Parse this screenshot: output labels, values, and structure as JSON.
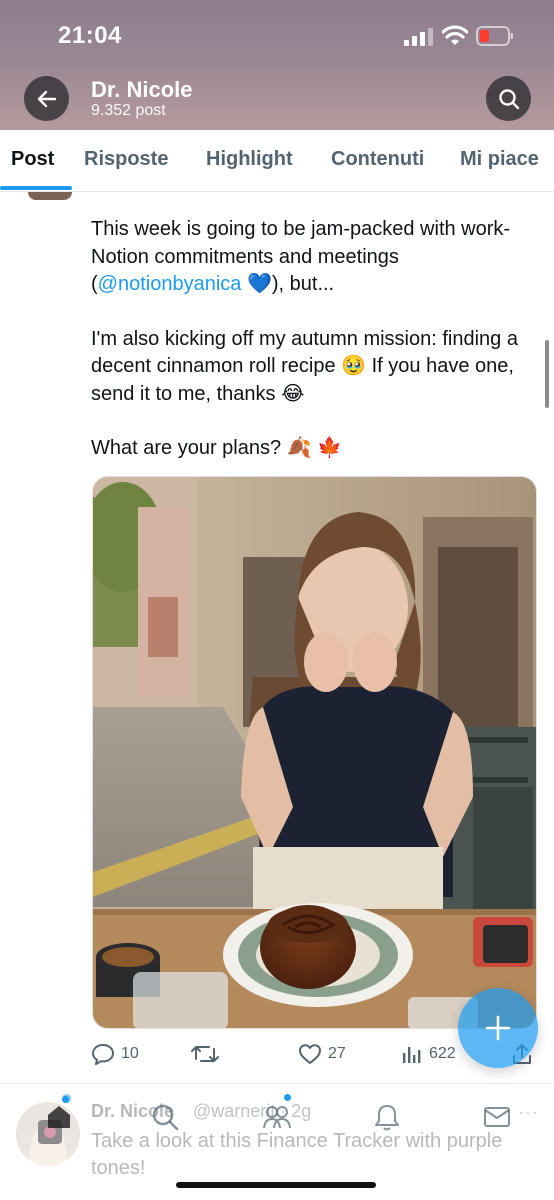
{
  "status_bar": {
    "time": "21:04"
  },
  "header": {
    "title": "Dr. Nicole",
    "subtitle": "9.352 post",
    "back_icon": "arrow-left-icon",
    "search_icon": "search-icon"
  },
  "tabs": [
    {
      "label": "Post",
      "active": true
    },
    {
      "label": "Risposte",
      "active": false
    },
    {
      "label": "Highlight",
      "active": false
    },
    {
      "label": "Contenuti",
      "active": false
    },
    {
      "label": "Mi piace",
      "active": false
    }
  ],
  "post": {
    "line1": "This week is going to be jam-packed with work-Notion commitments and meetings (",
    "mention": "@notionbyanica",
    "line1_end": " 💙), but...",
    "paragraph2": "I'm also kicking off my autumn mission: finding a decent cinnamon roll recipe 🥹 If you have one, send it to me, thanks 😂",
    "paragraph3": "What are your plans? 🍂 🍁",
    "actions": {
      "replies": "10",
      "retweets": "",
      "likes": "27",
      "views": "622"
    }
  },
  "next_post": {
    "name": "Dr. Nicole",
    "handle": "@warnerit · 2g",
    "text": "Take a look at this Finance Tracker with purple tones!"
  },
  "colors": {
    "accent": "#1d9bf0",
    "header_gradient_top": "#8e7c8e",
    "header_gradient_bottom": "#b59a9c",
    "muted_text": "#536471"
  }
}
